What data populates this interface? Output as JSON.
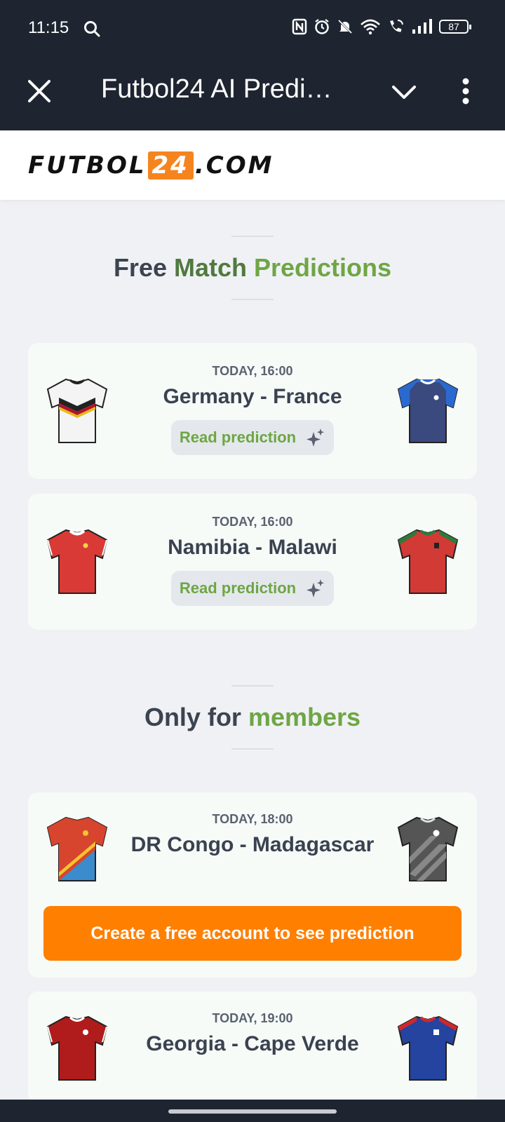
{
  "status_bar": {
    "time": "11:15",
    "battery": "87",
    "icons": [
      "search-icon",
      "nfc-icon",
      "alarm-icon",
      "mute-icon",
      "wifi-icon",
      "wifi-calling-icon",
      "signal-icon",
      "battery-icon"
    ]
  },
  "app_bar": {
    "title": "Futbol24 AI Predi…",
    "icons": [
      "close-icon",
      "chevron-down-icon",
      "more-vert-icon"
    ]
  },
  "logo": {
    "text_left": "FUTBOL",
    "text_num": "24",
    "text_right": ".COM"
  },
  "sections": {
    "free": {
      "word1": "Free ",
      "word2": "Match ",
      "word3": "Predictions"
    },
    "members": {
      "word1": "Only for ",
      "word2": "members"
    }
  },
  "matches": [
    {
      "time": "TODAY, 16:00",
      "teams": "Germany - France",
      "action": "Read prediction",
      "home_shirt": "germany-shirt",
      "away_shirt": "france-shirt"
    },
    {
      "time": "TODAY, 16:00",
      "teams": "Namibia - Malawi",
      "action": "Read prediction",
      "home_shirt": "namibia-shirt",
      "away_shirt": "malawi-shirt"
    },
    {
      "time": "TODAY, 18:00",
      "teams": "DR Congo - Madagascar",
      "action": "Create a free account to see prediction",
      "home_shirt": "dr-congo-shirt",
      "away_shirt": "madagascar-shirt"
    },
    {
      "time": "TODAY, 19:00",
      "teams": "Georgia - Cape Verde",
      "home_shirt": "georgia-shirt",
      "away_shirt": "cape-verde-shirt"
    }
  ],
  "colors": {
    "header_bg": "#1e2530",
    "accent_orange": "#ff7f00",
    "accent_green": "#6ea644",
    "page_bg": "#f0f1f5"
  }
}
